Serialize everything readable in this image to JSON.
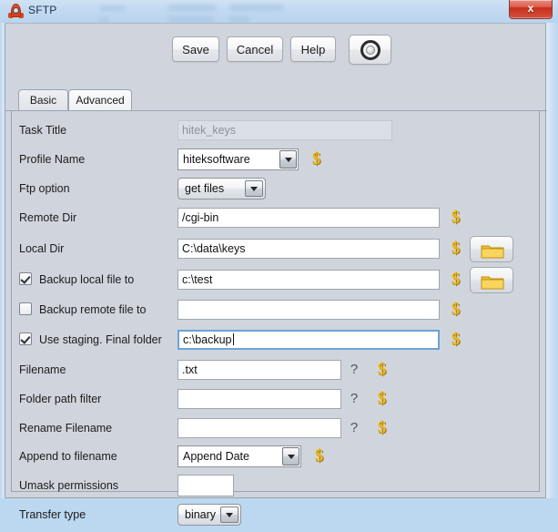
{
  "window": {
    "title": "SFTP",
    "app_icon": "rocket-icon",
    "close_label": "x"
  },
  "toolbar": {
    "save_label": "Save",
    "cancel_label": "Cancel",
    "help_label": "Help",
    "tool_icon": "target-wheel-icon"
  },
  "tabs": [
    {
      "label": "Basic",
      "selected": true
    },
    {
      "label": "Advanced",
      "selected": false
    }
  ],
  "icons": {
    "dollar": "$",
    "question": "?",
    "folder": "folder-icon"
  },
  "form": {
    "task_title": {
      "label": "Task Title",
      "value": "hitek_keys",
      "disabled": true
    },
    "profile_name": {
      "label": "Profile Name",
      "value": "hiteksoftware"
    },
    "ftp_option": {
      "label": "Ftp option",
      "value": "get files"
    },
    "remote_dir": {
      "label": "Remote Dir",
      "value": "/cgi-bin"
    },
    "local_dir": {
      "label": "Local Dir",
      "value": "C:\\data\\keys"
    },
    "backup_local": {
      "label": "Backup local file to",
      "value": "c:\\test",
      "checked": true
    },
    "backup_remote": {
      "label": "Backup remote file to",
      "value": "",
      "checked": false
    },
    "use_staging": {
      "label": "Use staging.  Final folder",
      "value": "c:\\backup",
      "checked": true,
      "focused": true
    },
    "filename": {
      "label": "Filename",
      "value": ".txt"
    },
    "folder_path_filter": {
      "label": "Folder path filter",
      "value": ""
    },
    "rename_filename": {
      "label": "Rename Filename",
      "value": ""
    },
    "append_to_filename": {
      "label": "Append to filename",
      "value": "Append Date"
    },
    "umask_permissions": {
      "label": "Umask permissions",
      "value": ""
    },
    "transfer_type": {
      "label": "Transfer type",
      "value": "binary"
    }
  },
  "colors": {
    "dollar_icon": "#e8b629",
    "folder_icon": "#f2c230",
    "panel_bg": "#d0d5dd",
    "close_button": "#c8301c",
    "focus_border": "#6aa3d8"
  }
}
